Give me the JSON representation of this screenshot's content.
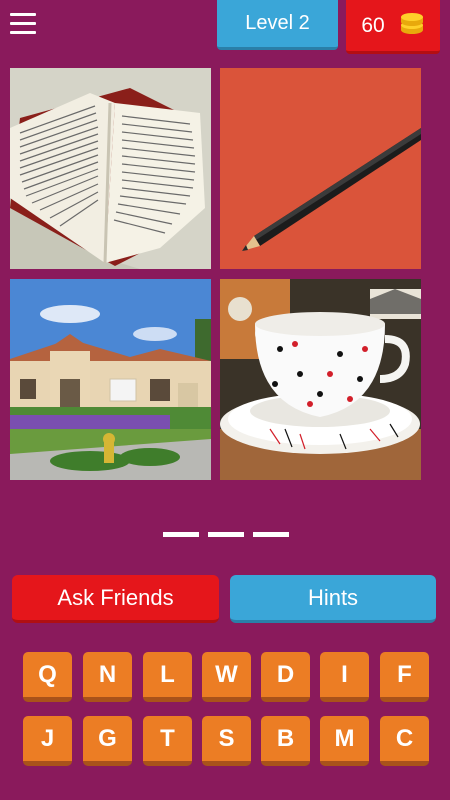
{
  "header": {
    "level_label": "Level 2",
    "coins": "60"
  },
  "answer": {
    "slot_count": 3
  },
  "buttons": {
    "ask_friends": "Ask Friends",
    "hints": "Hints"
  },
  "keyboard": {
    "row1": [
      "Q",
      "N",
      "L",
      "W",
      "D",
      "I",
      "F"
    ],
    "row2": [
      "J",
      "G",
      "T",
      "S",
      "B",
      "M",
      "C"
    ]
  },
  "pictures": [
    "open-book",
    "pencil",
    "house",
    "teacup"
  ],
  "colors": {
    "background": "#8a1a5c",
    "level_blue": "#3aa6d8",
    "coin_red": "#e5161b",
    "key_orange": "#ec7d24"
  }
}
